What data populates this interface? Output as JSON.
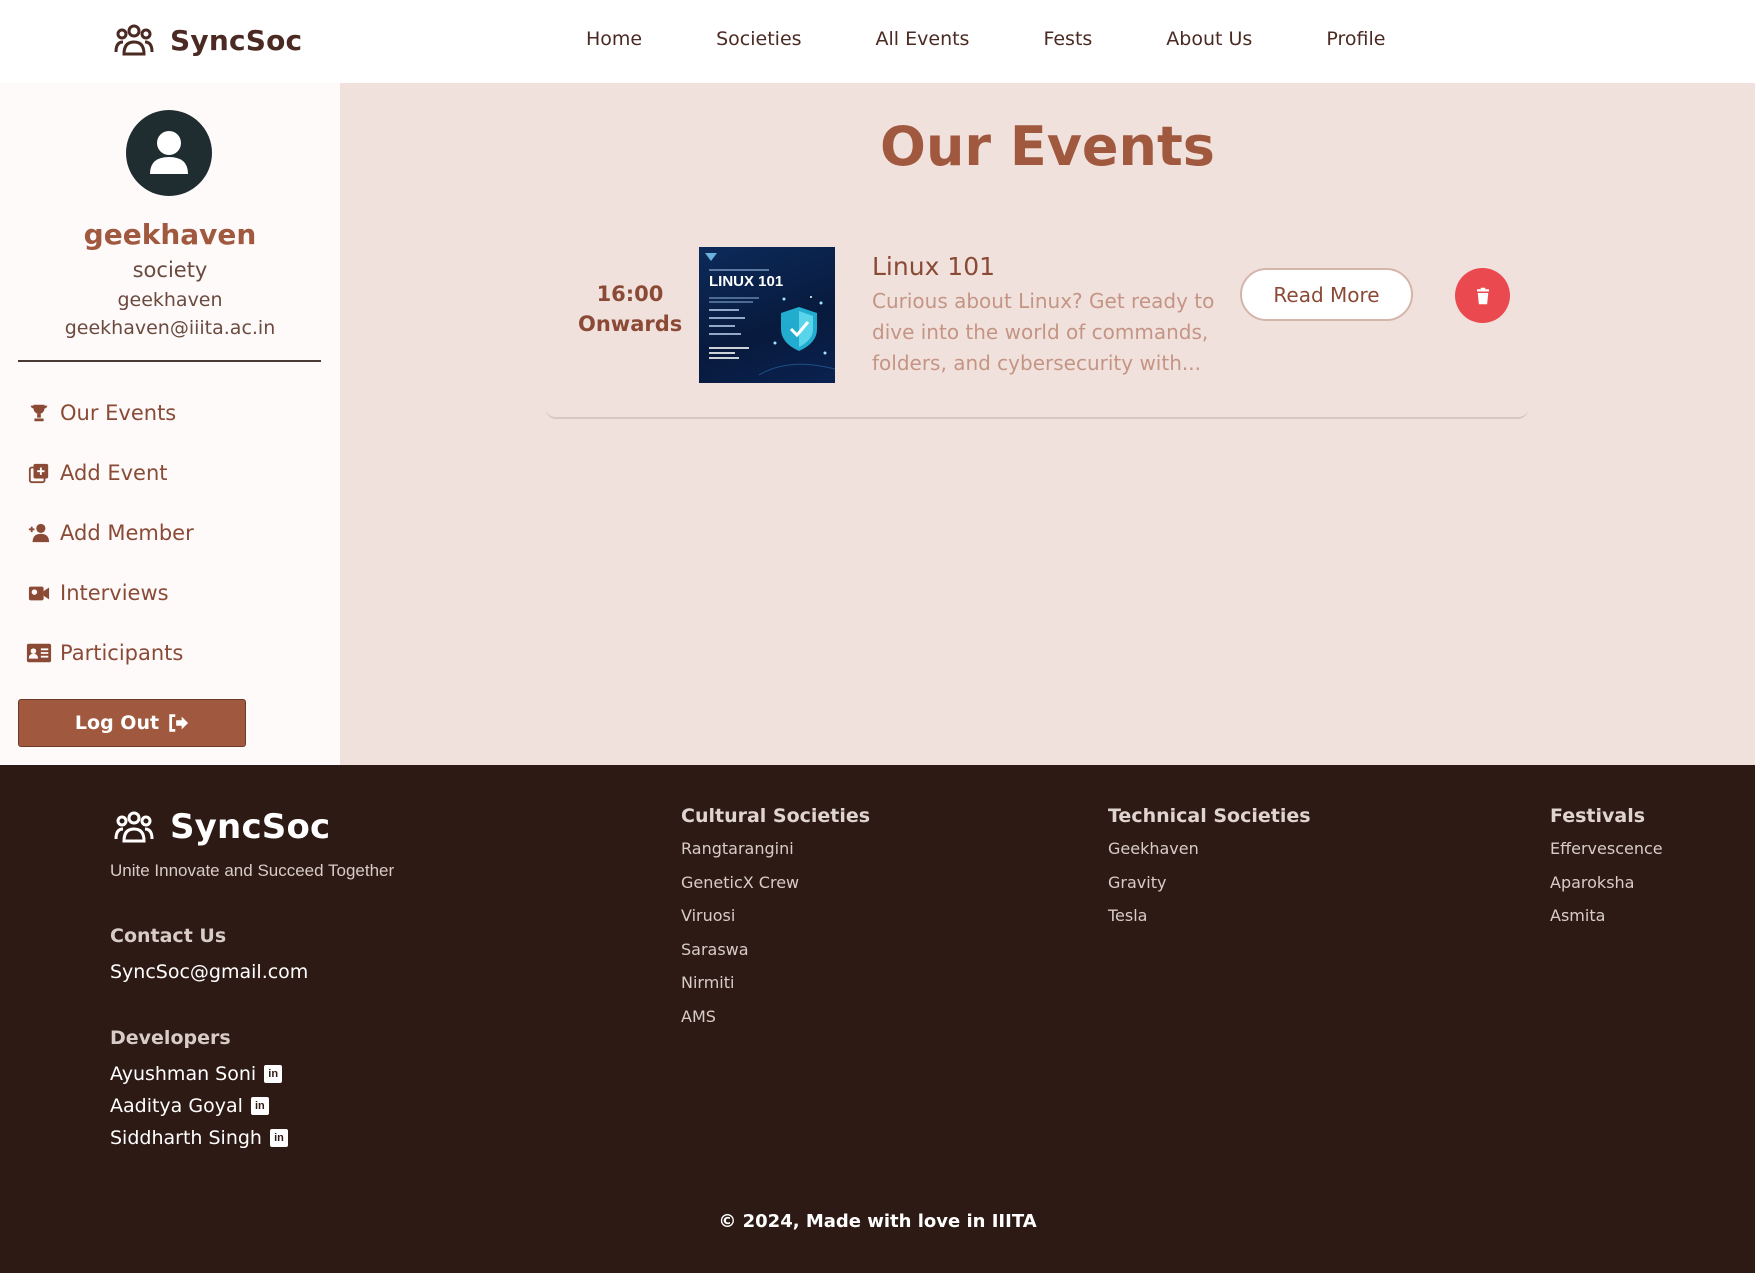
{
  "header": {
    "brand": "SyncSoc",
    "nav": [
      "Home",
      "Societies",
      "All Events",
      "Fests",
      "About Us",
      "Profile"
    ]
  },
  "sidebar": {
    "society_name": "geekhaven",
    "society_type": "society",
    "handle": "geekhaven",
    "email": "geekhaven@iiita.ac.in",
    "items": [
      {
        "label": "Our Events",
        "icon": "trophy-icon"
      },
      {
        "label": "Add Event",
        "icon": "add-box-icon"
      },
      {
        "label": "Add Member",
        "icon": "user-plus-icon"
      },
      {
        "label": "Interviews",
        "icon": "video-icon"
      },
      {
        "label": "Participants",
        "icon": "id-card-icon"
      }
    ],
    "logout_label": "Log Out"
  },
  "main": {
    "title": "Our Events",
    "events": [
      {
        "time": "16:00",
        "time_suffix": "Onwards",
        "poster_title": "LINUX 101",
        "name": "Linux 101",
        "description": "Curious about Linux? Get ready to dive into the world of commands, folders, and cybersecurity with...",
        "read_more_label": "Read More"
      }
    ]
  },
  "footer": {
    "brand": "SyncSoc",
    "tagline": "Unite Innovate and Succeed Together",
    "contact_heading": "Contact Us",
    "contact_email": "SyncSoc@gmail.com",
    "developers_heading": "Developers",
    "developers": [
      "Ayushman Soni",
      "Aaditya Goyal",
      "Siddharth Singh"
    ],
    "columns": [
      {
        "heading": "Cultural Societies",
        "links": [
          "Rangtarangini",
          "GeneticX Crew",
          "Viruosi",
          "Saraswa",
          "Nirmiti",
          "AMS"
        ]
      },
      {
        "heading": "Technical Societies",
        "links": [
          "Geekhaven",
          "Gravity",
          "Tesla"
        ]
      },
      {
        "heading": "Festivals",
        "links": [
          "Effervescence",
          "Aparoksha",
          "Asmita"
        ]
      }
    ],
    "copyright": "© 2024, Made with love in IIITA"
  },
  "colors": {
    "accent": "#a0583e",
    "main_bg": "#f1e1dc",
    "footer_bg": "#2e1a14",
    "delete": "#ea4a4f"
  }
}
